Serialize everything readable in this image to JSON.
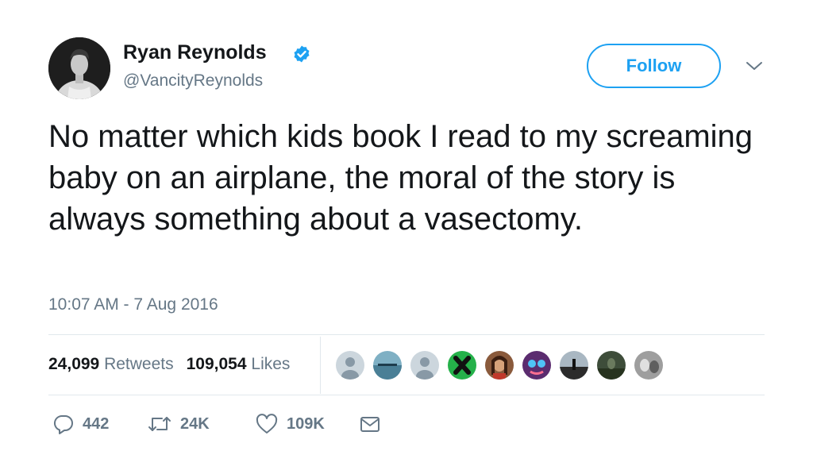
{
  "author": {
    "name": "Ryan Reynolds",
    "handle": "@VancityReynolds",
    "avatar_icon": "profile-photo",
    "verified_icon": "verified-badge-icon"
  },
  "follow_button": {
    "label": "Follow"
  },
  "tweet": {
    "text": "No matter which kids book I read to my screaming baby on an airplane, the moral of the story is always something about a vasectomy.",
    "timestamp": "10:07 AM - 7 Aug 2016"
  },
  "stats": {
    "retweets_count": "24,099",
    "retweets_label": "Retweets",
    "likes_count": "109,054",
    "likes_label": "Likes"
  },
  "actions": {
    "reply_count": "442",
    "retweet_count": "24K",
    "like_count": "109K"
  },
  "colors": {
    "accent": "#1da1f2",
    "text": "#14171a",
    "muted": "#657786",
    "border": "#e1e8ed"
  }
}
